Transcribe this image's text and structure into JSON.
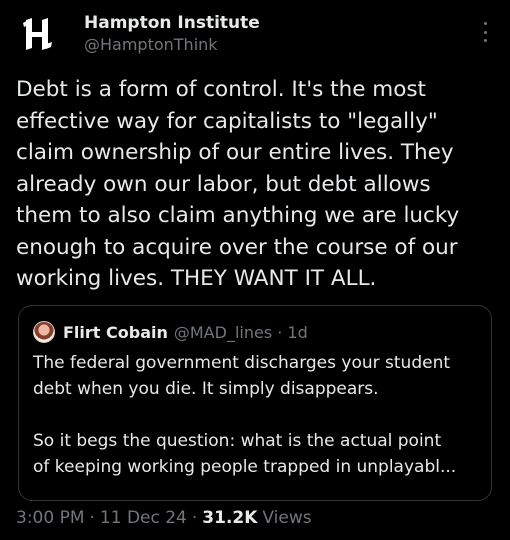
{
  "author": {
    "display_name": "Hampton Institute",
    "handle": "@HamptonThink",
    "avatar_icon": "hampton-h-logo"
  },
  "tweet": {
    "text": "Debt is a form of control. It's the most\neffective way for capitalists to \"legally\"\nclaim ownership of our entire lives. They\nalready own our labor, but debt allows\nthem to also claim anything we are lucky\nenough to acquire over the course of our\nworking lives. THEY WANT IT ALL."
  },
  "quote": {
    "display_name": "Flirt Cobain",
    "handle_time": "@MAD_lines · 1d",
    "text": "The federal government discharges your student\ndebt when you die. It simply disappears.\n\nSo it begs the question: what is the actual point\nof keeping working people trapped in unplayabl..."
  },
  "meta": {
    "time": "3:00 PM",
    "date": "11 Dec 24",
    "views_count": "31.2K",
    "views_label": "Views"
  },
  "colors": {
    "background": "#000000",
    "text": "#e7e9ea",
    "secondary": "#71767b",
    "border": "#2f3336"
  }
}
